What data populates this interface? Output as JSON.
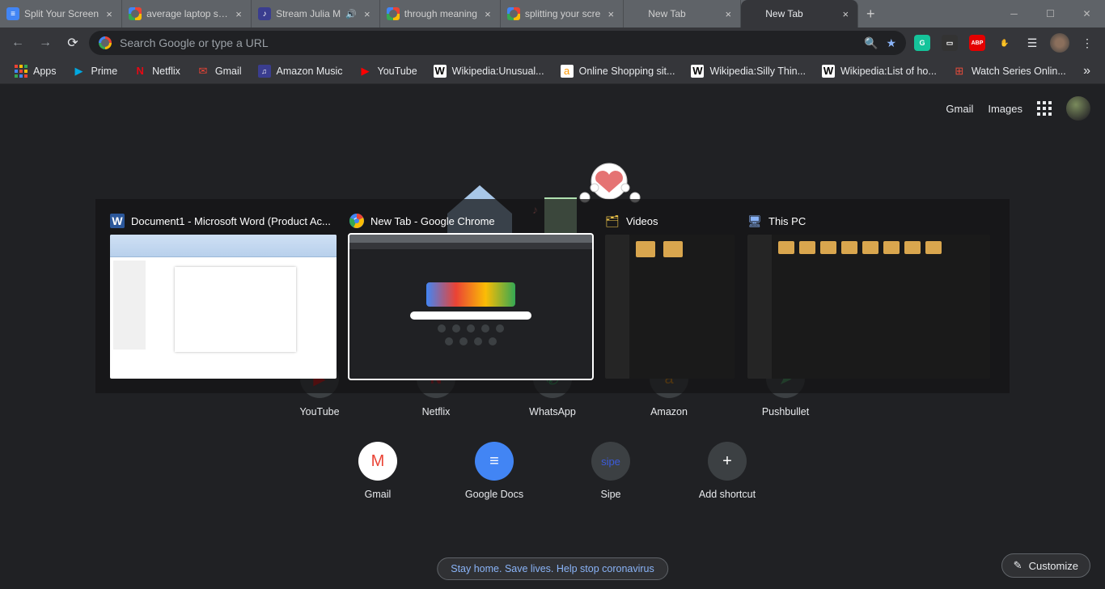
{
  "tabs": [
    {
      "title": "Split Your Screen",
      "favicon": "docs",
      "audio": false
    },
    {
      "title": "average laptop scre",
      "favicon": "google",
      "audio": false
    },
    {
      "title": "Stream Julia M",
      "favicon": "sc",
      "audio": true
    },
    {
      "title": "through meaning",
      "favicon": "google",
      "audio": false
    },
    {
      "title": "splitting your scre",
      "favicon": "google",
      "audio": false
    },
    {
      "title": "New Tab",
      "favicon": "",
      "audio": false
    },
    {
      "title": "New Tab",
      "favicon": "",
      "audio": false,
      "active": true
    }
  ],
  "omnibox": {
    "placeholder": "Search Google or type a URL"
  },
  "bookmarks": [
    {
      "label": "Apps",
      "icon": "apps"
    },
    {
      "label": "Prime",
      "icon": "prime"
    },
    {
      "label": "Netflix",
      "icon": "netflix"
    },
    {
      "label": "Gmail",
      "icon": "gmail"
    },
    {
      "label": "Amazon Music",
      "icon": "amzmusic"
    },
    {
      "label": "YouTube",
      "icon": "youtube"
    },
    {
      "label": "Wikipedia:Unusual...",
      "icon": "wiki"
    },
    {
      "label": "Online Shopping sit...",
      "icon": "amazon"
    },
    {
      "label": "Wikipedia:Silly Thin...",
      "icon": "wiki"
    },
    {
      "label": "Wikipedia:List of ho...",
      "icon": "wiki"
    },
    {
      "label": "Watch Series Onlin...",
      "icon": "watch"
    }
  ],
  "ntp_header": {
    "gmail": "Gmail",
    "images": "Images"
  },
  "shortcuts_row1": [
    {
      "label": "YouTube",
      "color": "#ff0000",
      "glyph": "▶"
    },
    {
      "label": "Netflix",
      "color": "#e50914",
      "glyph": "N"
    },
    {
      "label": "WhatsApp",
      "color": "#25d366",
      "glyph": "✆"
    },
    {
      "label": "Amazon",
      "color": "#ff9900",
      "glyph": "a"
    },
    {
      "label": "Pushbullet",
      "color": "#4ab367",
      "glyph": "➤"
    }
  ],
  "shortcuts_row2": [
    {
      "label": "Gmail",
      "color": "#ea4335",
      "glyph": "M"
    },
    {
      "label": "Google Docs",
      "color": "#4285f4",
      "glyph": "≡"
    },
    {
      "label": "Sipe",
      "color": "#3b5bdb",
      "glyph": "s"
    },
    {
      "label": "Add shortcut",
      "color": "",
      "glyph": "+"
    }
  ],
  "covid_message": "Stay home. Save lives. Help stop coronavirus",
  "customize_label": "Customize",
  "alttab": [
    {
      "title": "Document1 - Microsoft Word (Product Ac...",
      "icon": "word"
    },
    {
      "title": "New Tab - Google Chrome",
      "icon": "chrome",
      "selected": true
    },
    {
      "title": "Videos",
      "icon": "explorer"
    },
    {
      "title": "This PC",
      "icon": "pc"
    }
  ],
  "extensions": [
    {
      "name": "grammarly",
      "bg": "#15c39a",
      "fg": "#fff",
      "text": "G"
    },
    {
      "name": "reader",
      "bg": "#333",
      "fg": "#fff",
      "text": "▭"
    },
    {
      "name": "abp",
      "bg": "#e40000",
      "fg": "#fff",
      "text": "ABP"
    },
    {
      "name": "other",
      "bg": "#f5b400",
      "fg": "#000",
      "text": "✋"
    }
  ]
}
